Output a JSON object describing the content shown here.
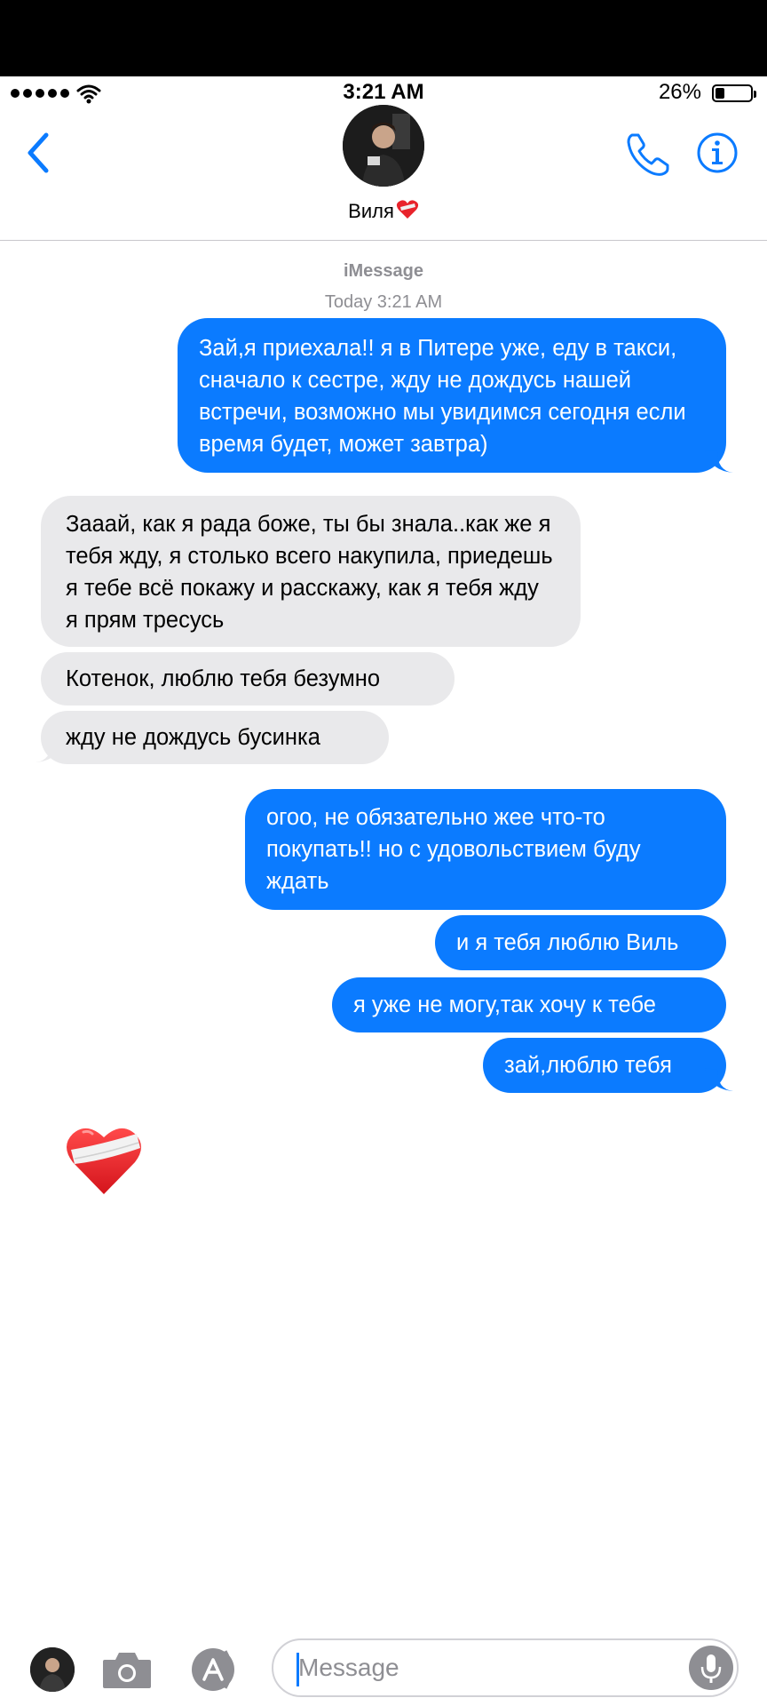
{
  "status_bar": {
    "time": "3:21 AM",
    "battery": "26%",
    "battery_level": 0.26
  },
  "header": {
    "contact_name": "Виля",
    "back_icon": "chevron-left-icon",
    "call_icon": "phone-icon",
    "info_icon": "info-icon"
  },
  "thread": {
    "service": "iMessage",
    "timestamp": "Today 3:21 AM",
    "messages": [
      {
        "from": "me",
        "text": "Зай,я приехала!! я в Питере уже, еду в такси, сначало к сестре, жду не дождусь нашей встречи, возможно мы увидимся сегодня если время будет, может завтра)"
      },
      {
        "from": "them",
        "text": "Зааай, как я рада боже, ты бы знала..как же я тебя жду, я столько всего накупила, приедешь я тебе всё покажу и расскажу, как я тебя жду я прям тресусь"
      },
      {
        "from": "them",
        "text": "Котенок, люблю тебя безумно"
      },
      {
        "from": "them",
        "text": "жду не дождусь бусинка"
      },
      {
        "from": "me",
        "text": "огоо, не обязательно жее что-то покупать!! но с удовольствием буду ждать"
      },
      {
        "from": "me",
        "text": "и я тебя люблю Виль"
      },
      {
        "from": "me",
        "text": "я уже не могу,так хочу к тебе"
      },
      {
        "from": "me",
        "text": "зай,люблю тебя"
      },
      {
        "from": "them",
        "emoji": "mending-heart-icon"
      }
    ]
  },
  "composer": {
    "placeholder": "Message",
    "camera_icon": "camera-icon",
    "apps_icon": "app-store-icon",
    "mic_icon": "microphone-icon"
  },
  "colors": {
    "outgoing": "#0b7bff",
    "incoming": "#e9e9eb",
    "accent": "#0b7bff"
  }
}
